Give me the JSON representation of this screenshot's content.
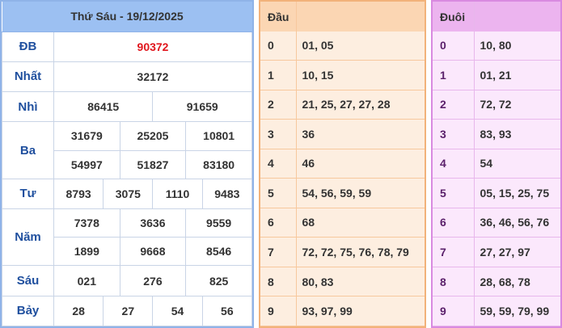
{
  "prize_table": {
    "title": "Thứ Sáu - 19/12/2025",
    "rows": [
      {
        "label": "ĐB",
        "values": [
          "90372"
        ]
      },
      {
        "label": "Nhất",
        "values": [
          "32172"
        ]
      },
      {
        "label": "Nhì",
        "values": [
          "86415",
          "91659"
        ]
      },
      {
        "label": "Ba",
        "values": [
          "31679",
          "25205",
          "10801",
          "54997",
          "51827",
          "83180"
        ]
      },
      {
        "label": "Tư",
        "values": [
          "8793",
          "3075",
          "1110",
          "9483"
        ]
      },
      {
        "label": "Năm",
        "values": [
          "7378",
          "3636",
          "9559",
          "1899",
          "9668",
          "8546"
        ]
      },
      {
        "label": "Sáu",
        "values": [
          "021",
          "276",
          "825"
        ]
      },
      {
        "label": "Bảy",
        "values": [
          "28",
          "27",
          "54",
          "56"
        ]
      }
    ]
  },
  "head_table": {
    "title": "Đầu",
    "rows": [
      {
        "key": "0",
        "value": "01, 05"
      },
      {
        "key": "1",
        "value": "10, 15"
      },
      {
        "key": "2",
        "value": "21, 25, 27, 27, 28"
      },
      {
        "key": "3",
        "value": "36"
      },
      {
        "key": "4",
        "value": "46"
      },
      {
        "key": "5",
        "value": "54, 56, 59, 59"
      },
      {
        "key": "6",
        "value": "68"
      },
      {
        "key": "7",
        "value": "72, 72, 75, 76, 78, 79"
      },
      {
        "key": "8",
        "value": "80, 83"
      },
      {
        "key": "9",
        "value": "93, 97, 99"
      }
    ]
  },
  "tail_table": {
    "title": "Đuôi",
    "rows": [
      {
        "key": "0",
        "value": "10, 80"
      },
      {
        "key": "1",
        "value": "01, 21"
      },
      {
        "key": "2",
        "value": "72, 72"
      },
      {
        "key": "3",
        "value": "83, 93"
      },
      {
        "key": "4",
        "value": "54"
      },
      {
        "key": "5",
        "value": "05, 15, 25, 75"
      },
      {
        "key": "6",
        "value": "36, 46, 56, 76"
      },
      {
        "key": "7",
        "value": "27, 27, 97"
      },
      {
        "key": "8",
        "value": "28, 68, 78"
      },
      {
        "key": "9",
        "value": "59, 59, 79, 99"
      }
    ]
  },
  "colors": {
    "special_prize": "#e0161d",
    "label_text": "#1f4f9e",
    "prize_header": "#9cc0f2",
    "head_header": "#fbd6b3",
    "tail_header": "#ecb4ef"
  }
}
